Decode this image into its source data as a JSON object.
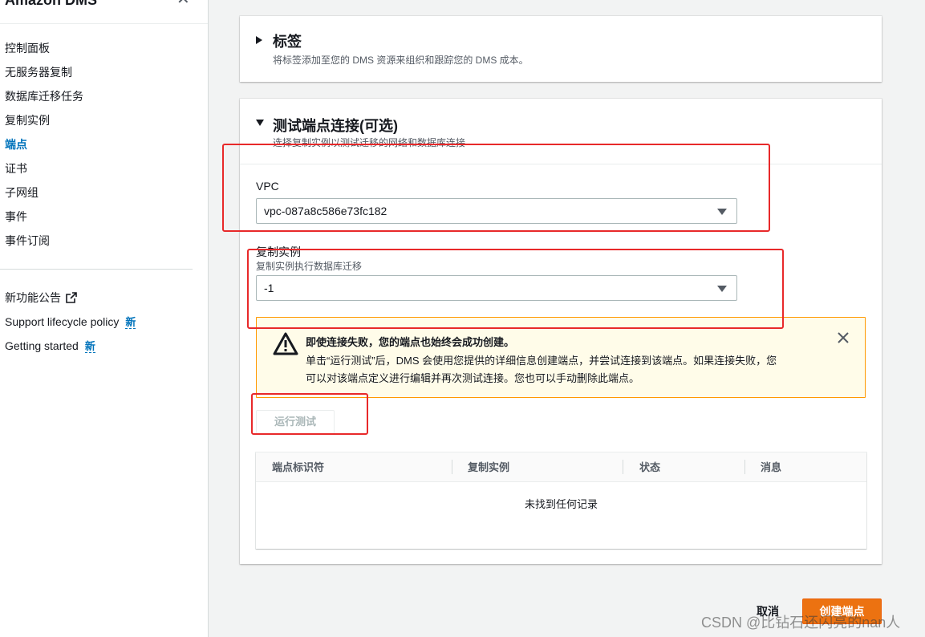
{
  "sidebar": {
    "header": "Amazon DMS",
    "items": [
      {
        "label": "控制面板"
      },
      {
        "label": "无服务器复制"
      },
      {
        "label": "数据库迁移任务"
      },
      {
        "label": "复制实例"
      },
      {
        "label": "端点"
      },
      {
        "label": "证书"
      },
      {
        "label": "子网组"
      },
      {
        "label": "事件"
      },
      {
        "label": "事件订阅"
      }
    ],
    "active_item": "端点",
    "links": [
      {
        "label": "新功能公告"
      },
      {
        "label": "Support lifecycle policy",
        "badge": "新"
      },
      {
        "label": "Getting started",
        "badge": "新"
      }
    ]
  },
  "tags_panel": {
    "title": "标签",
    "description": "将标签添加至您的 DMS 资源来组织和跟踪您的 DMS 成本。"
  },
  "test_panel": {
    "title": "测试端点连接(可选)",
    "description": "选择复制实例以测试迁移的网络和数据库连接",
    "vpc": {
      "label": "VPC",
      "value": "vpc-087a8c586e73fc182"
    },
    "replication_instance": {
      "label": "复制实例",
      "description": "复制实例执行数据库迁移",
      "value": "-1"
    },
    "alert": {
      "title": "即使连接失败，您的端点也始终会成功创建。",
      "line1": "单击“运行测试”后，DMS 会使用您提供的详细信息创建端点，并尝试连接到该端点。如果连接失败，您",
      "line2": "可以对该端点定义进行编辑并再次测试连接。您也可以手动删除此端点。"
    },
    "run_test_label": "运行测试",
    "table": {
      "columns": [
        "端点标识符",
        "复制实例",
        "状态",
        "消息"
      ],
      "empty_text": "未找到任何记录"
    }
  },
  "footer": {
    "cancel_label": "取消",
    "create_label": "创建端点"
  },
  "watermark": "CSDN @比钻石还闪亮的nan人",
  "colors": {
    "accent_link": "#0073bb",
    "primary_button": "#ec7211",
    "annotation_box": "#e8292a",
    "alert_border": "#ff9900"
  }
}
